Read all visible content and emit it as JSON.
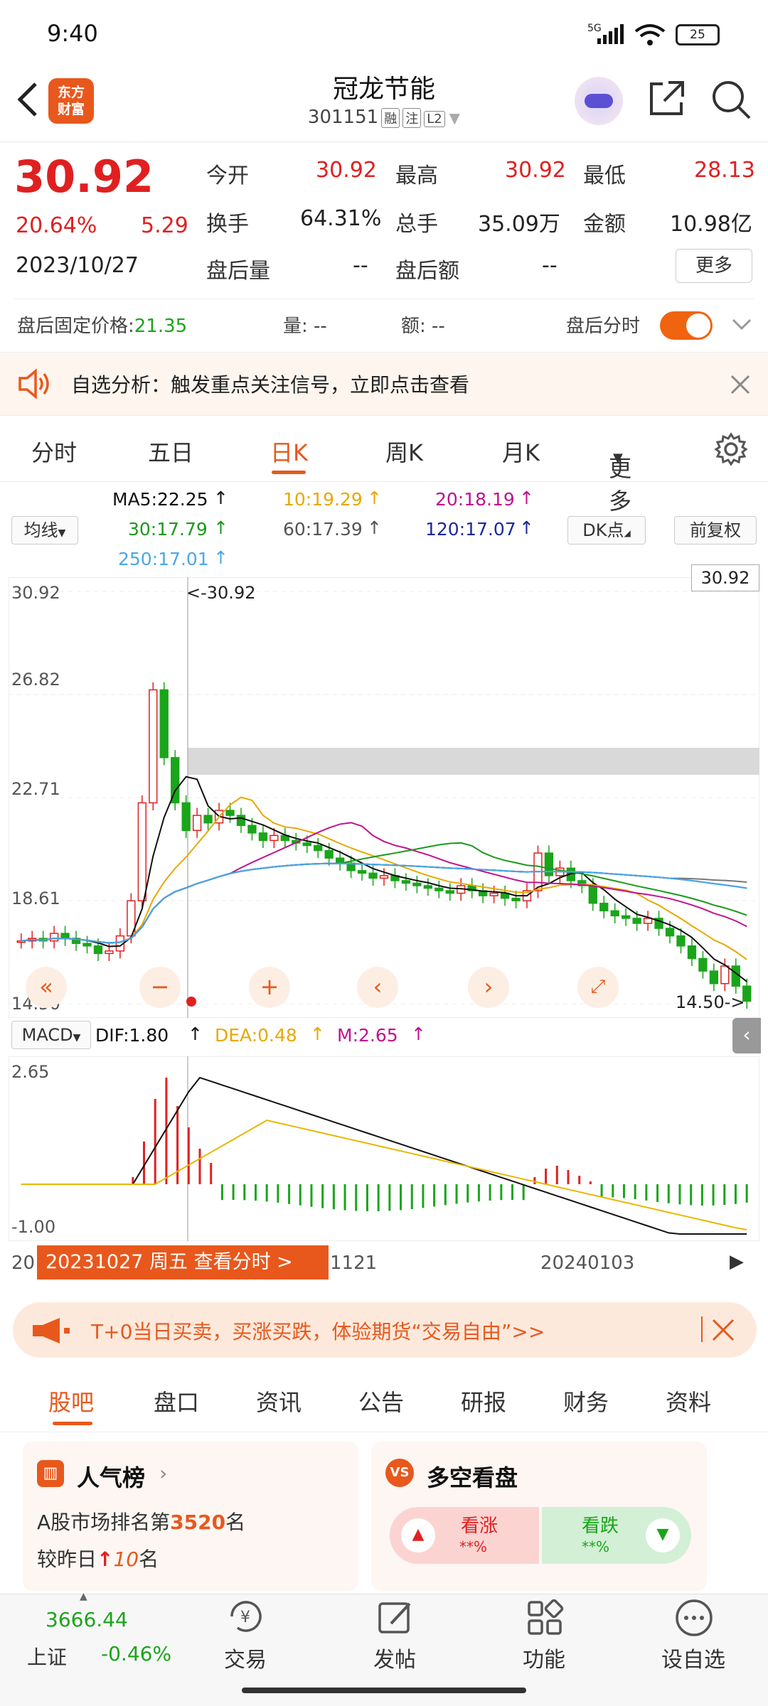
{
  "status": {
    "time": "9:40",
    "network": "5G",
    "battery": "25"
  },
  "header": {
    "logo": "东方\n财富",
    "title": "冠龙节能",
    "code": "301151",
    "tags": [
      "融",
      "注",
      "L2"
    ]
  },
  "quote": {
    "price": "30.92",
    "pct": "20.64%",
    "change": "5.29",
    "date": "2023/10/27",
    "open_label": "今开",
    "open": "30.92",
    "high_label": "最高",
    "high": "30.92",
    "low_label": "最低",
    "low": "28.13",
    "turnover_label": "换手",
    "turnover": "64.31%",
    "volume_label": "总手",
    "volume": "35.09万",
    "amount_label": "金额",
    "amount": "10.98亿",
    "ah_vol_label": "盘后量",
    "ah_vol": "--",
    "ah_amt_label": "盘后额",
    "ah_amt": "--",
    "more": "更多"
  },
  "afterhours": {
    "price_label": "盘后固定价格:",
    "price": "21.35",
    "vol": "量: --",
    "amt": "额: --",
    "toggle_label": "盘后分时"
  },
  "notice": {
    "text": "自选分析：触发重点关注信号，立即点击查看"
  },
  "tabs": [
    "分时",
    "五日",
    "日K",
    "周K",
    "月K",
    "更多"
  ],
  "ma": {
    "selector": "均线",
    "ma5": "MA5:22.25",
    "ma10": "10:19.29",
    "ma20": "20:18.19",
    "ma30": "30:17.79",
    "ma60": "60:17.39",
    "ma120": "120:17.07",
    "ma250": "250:17.01",
    "dk": "DK点",
    "fq": "前复权"
  },
  "chart_data": {
    "type": "candlestick",
    "y_ticks": [
      "30.92",
      "26.82",
      "22.71",
      "18.61",
      "14.50"
    ],
    "max_label": "<-30.92",
    "min_label": "14.50->",
    "last_price": "30.92",
    "macd": {
      "selector": "MACD",
      "dif": "DIF:1.80",
      "dea": "DEA:0.48",
      "m": "M:2.65",
      "y_ticks": [
        "2.65",
        "-1.00"
      ]
    },
    "x_ticks": [
      "20",
      "1121",
      "20240103"
    ],
    "tooltip": "20231027 周五 查看分时 >"
  },
  "colors": {
    "up": "#e02020",
    "down": "#1aa51a",
    "accent": "#e8581c"
  },
  "promo": {
    "text": "T+0当日买卖，买涨买跌，体验期货“交易自由”>>"
  },
  "subtabs": [
    "股吧",
    "盘口",
    "资讯",
    "公告",
    "研报",
    "财务",
    "资料"
  ],
  "cards": {
    "pop_title": "人气榜",
    "pop_line1a": "A股市场排名第",
    "pop_rank": "3520",
    "pop_line1b": "名",
    "pop_line2a": "较昨日",
    "pop_delta": "10",
    "pop_line2b": "名",
    "ls_title": "多空看盘",
    "bull": "看涨",
    "bear": "看跌",
    "bull_pct": "**%",
    "bear_pct": "**%"
  },
  "bottom": {
    "index_value": "3666.44",
    "index_name": "上证",
    "index_pct": "-0.46%",
    "trade": "交易",
    "post": "发帖",
    "func": "功能",
    "watch": "设自选"
  }
}
